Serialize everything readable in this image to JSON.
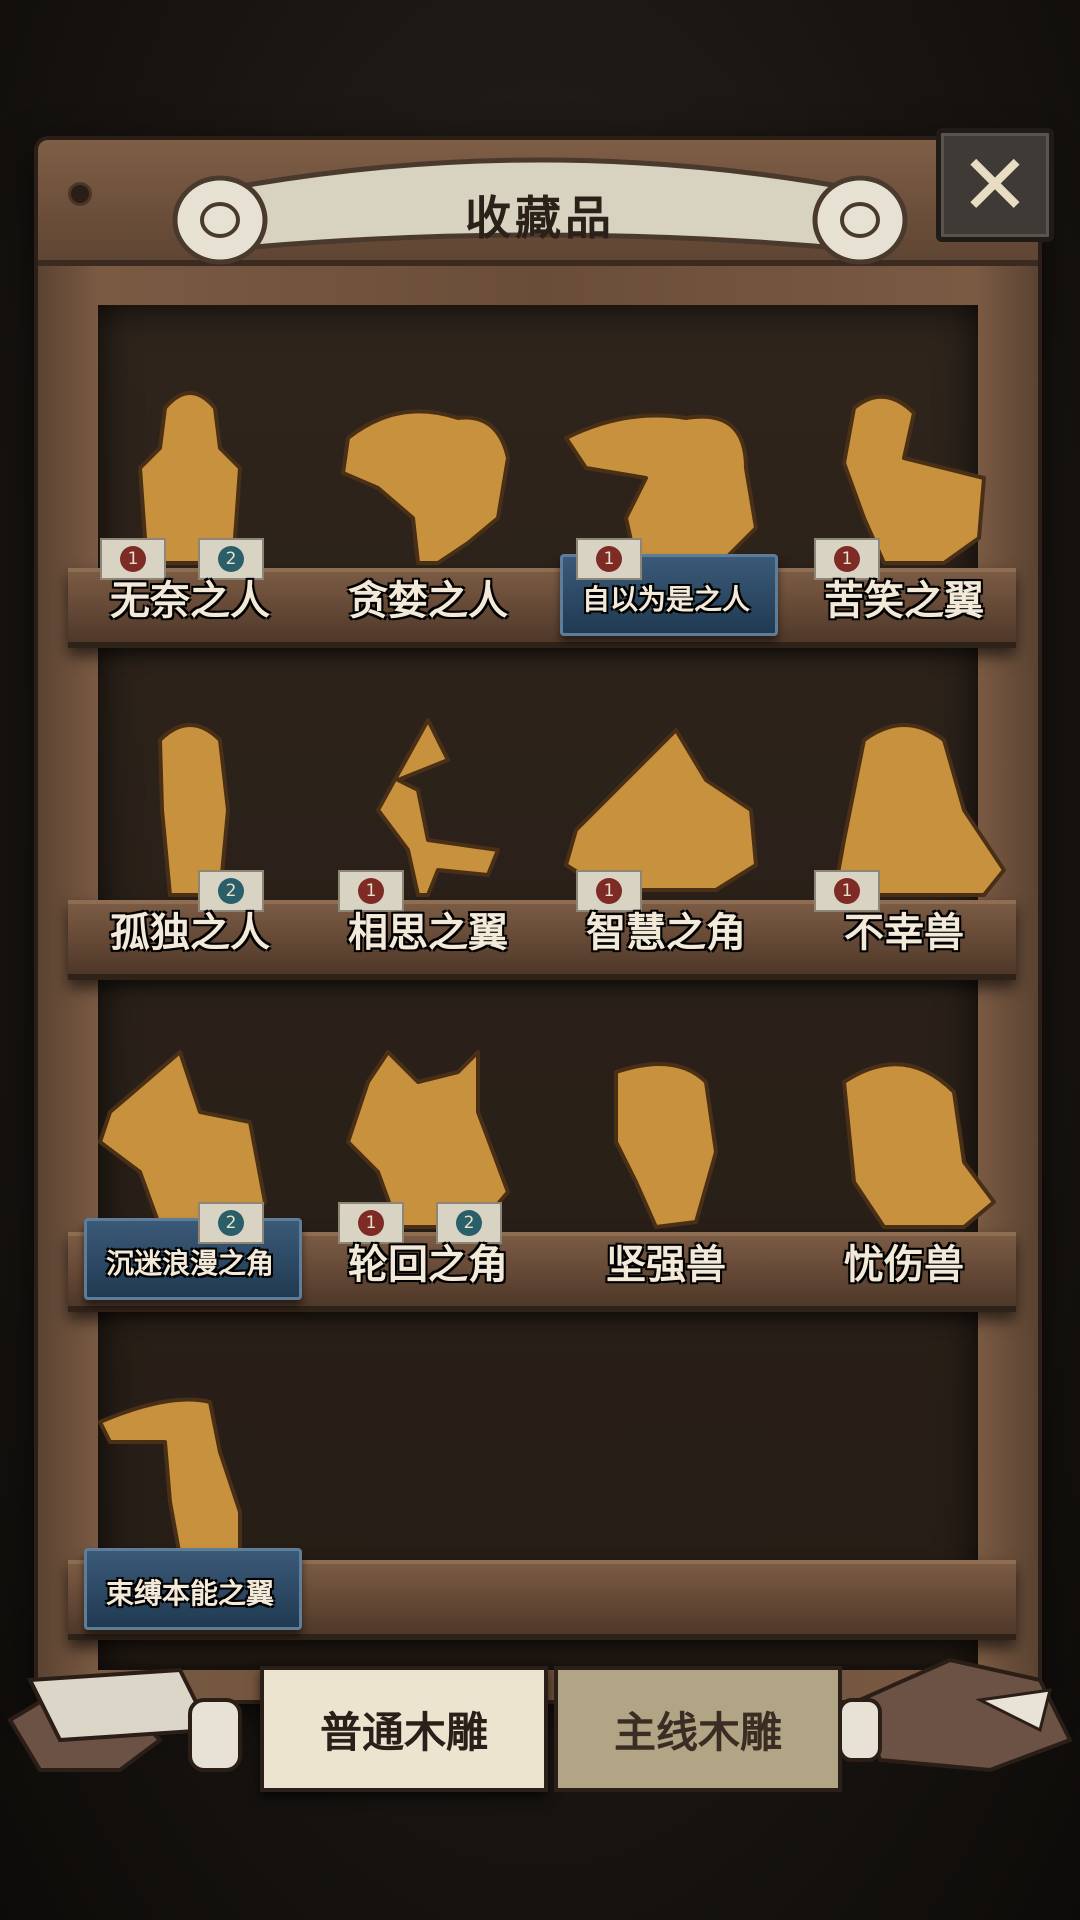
{
  "header": {
    "title": "收藏品"
  },
  "tabs": [
    {
      "label": "普通木雕",
      "active": true
    },
    {
      "label": "主线木雕",
      "active": false
    }
  ],
  "colors": {
    "wood": "#6a4d39",
    "parchment": "#ece4cf",
    "plate_blue": "#2f4a63",
    "badge_red": "#7e2a25",
    "badge_teal": "#2a5f6a"
  },
  "icons": {
    "close": "close-icon"
  },
  "items": [
    {
      "name": "无奈之人",
      "badges": [
        "1",
        "2"
      ],
      "highlight": false,
      "figure": "human"
    },
    {
      "name": "贪婪之人",
      "badges": [],
      "highlight": false,
      "figure": "beast"
    },
    {
      "name": "自以为是之人",
      "badges": [
        "1"
      ],
      "highlight": true,
      "figure": "tapir"
    },
    {
      "name": "苦笑之翼",
      "badges": [
        "1"
      ],
      "highlight": false,
      "figure": "bird"
    },
    {
      "name": "孤独之人",
      "badges": [
        "2"
      ],
      "highlight": false,
      "figure": "girl"
    },
    {
      "name": "相思之翼",
      "badges": [
        "1"
      ],
      "highlight": false,
      "figure": "heron"
    },
    {
      "name": "智慧之角",
      "badges": [
        "1"
      ],
      "highlight": false,
      "figure": "turtle"
    },
    {
      "name": "不幸兽",
      "badges": [
        "1"
      ],
      "highlight": false,
      "figure": "bear"
    },
    {
      "name": "沉迷浪漫之角",
      "badges": [
        "2"
      ],
      "highlight": true,
      "figure": "fox"
    },
    {
      "name": "轮回之角",
      "badges": [
        "1",
        "2"
      ],
      "highlight": false,
      "figure": "bull"
    },
    {
      "name": "坚强兽",
      "badges": [],
      "highlight": false,
      "figure": "pig"
    },
    {
      "name": "忧伤兽",
      "badges": [],
      "highlight": false,
      "figure": "armadillo"
    },
    {
      "name": "束缚本能之翼",
      "badges": [],
      "highlight": true,
      "figure": "toucan"
    }
  ]
}
